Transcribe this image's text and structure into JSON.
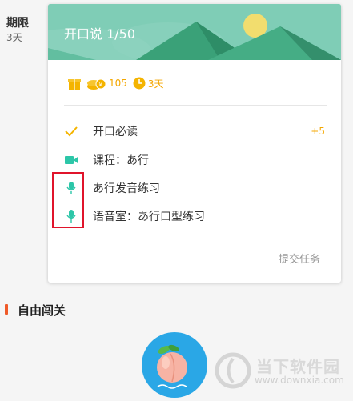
{
  "left": {
    "title": "期限",
    "value": "3天"
  },
  "card": {
    "title": "开口说 1/50",
    "stats": {
      "coins": "105",
      "time": "3天"
    },
    "tasks": [
      {
        "icon": "check-icon",
        "label": "开口必读",
        "points": "+5"
      },
      {
        "icon": "video-icon",
        "label": "课程：あ行",
        "points": ""
      },
      {
        "icon": "microphone-icon",
        "label": "あ行发音练习",
        "points": ""
      },
      {
        "icon": "microphone-icon",
        "label": "语音室：あ行口型练习",
        "points": ""
      }
    ],
    "submit_label": "提交任务"
  },
  "section": {
    "title": "自由闯关"
  },
  "watermark": {
    "text": "当下软件园",
    "url": "www.downxia.com"
  },
  "colors": {
    "accent": "#f4a700",
    "teal": "#2cc6a8",
    "banner": "#73c7b0",
    "highlight": "#e0142b",
    "section_bar": "#ef5a29",
    "circle": "#2aa7e6"
  }
}
